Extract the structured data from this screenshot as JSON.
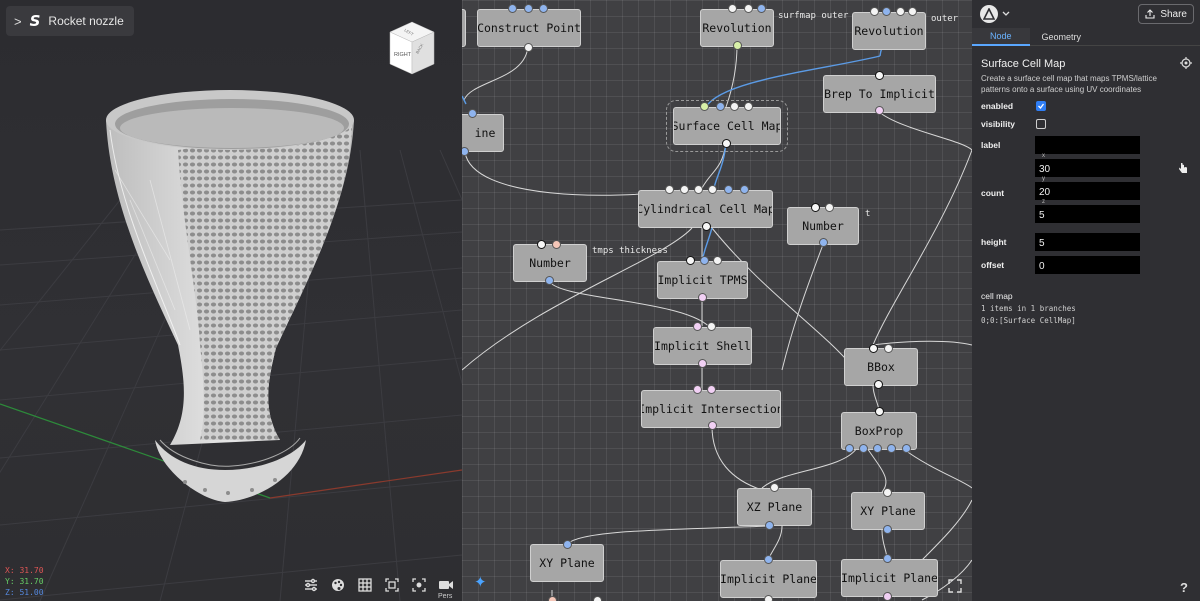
{
  "viewport": {
    "project_title": "Rocket nozzle",
    "logo_text": "S",
    "view_cube_faces": {
      "front": "RIGHT",
      "top_left": "LEFT",
      "top_right": "BACK"
    },
    "coords": {
      "x": "X: 31.70",
      "y": "Y: 31.70",
      "z": "Z: 51.00"
    },
    "toolbar": [
      "sliders-icon",
      "palette-icon",
      "grid-icon",
      "focus-icon",
      "fullscreen-icon",
      "camera-icon"
    ],
    "projection_label": "Pers"
  },
  "graph": {
    "nodes": {
      "construct_point": "Construct Point",
      "revolution_1": "Revolution",
      "revolution_2": "Revolution",
      "partial_line": "ine",
      "surface_cell_map": "Surface Cell Map",
      "brep_to_implicit": "Brep To Implicit",
      "cylindrical_cell_map": "Cylindrical Cell Map",
      "number_1": "Number",
      "number_2": "Number",
      "implicit_tpms": "Implicit TPMS",
      "implicit_shell": "Implicit Shell",
      "bbox": "BBox",
      "implicit_intersection": "Implicit Intersection",
      "boxprop": "BoxProp",
      "xz_plane": "XZ Plane",
      "xy_plane_1": "XY Plane",
      "xy_plane_2": "XY Plane",
      "implicit_plane_1": "Implicit Plane",
      "implicit_plane_2": "Implicit Plane"
    },
    "labels": {
      "surfmap_outer": "surfmap outer",
      "outer": "outer",
      "tmps_thickness": "tmps thickness",
      "t": "t"
    }
  },
  "panel": {
    "share_label": "Share",
    "tabs": [
      "Node",
      "Geometry"
    ],
    "active_tab": "Node",
    "node_title": "Surface Cell Map",
    "node_description": "Create a surface cell map that maps TPMS/lattice patterns onto a surface using UV coordinates",
    "props": {
      "enabled_label": "enabled",
      "enabled": true,
      "visibility_label": "visibility",
      "visibility": false,
      "label_label": "label",
      "label_value": "",
      "count_label": "count",
      "count_x": "30",
      "count_y": "20",
      "count_z": "5",
      "count_axes": {
        "x": "x",
        "y": "y",
        "z": "z"
      },
      "height_label": "height",
      "height_value": "5",
      "offset_label": "offset",
      "offset_value": "0"
    },
    "output": {
      "title": "cell map",
      "summary": "1 items in 1 branches",
      "entry": "0;0:[Surface CellMap]"
    },
    "help_label": "?"
  },
  "colors": {
    "accent": "#5aa7ff",
    "checkbox_on": "#2f7ef5",
    "node_fill": "#a6a6a6",
    "wire_blue": "#5b9be6",
    "wire_white": "#d8d8d8"
  }
}
